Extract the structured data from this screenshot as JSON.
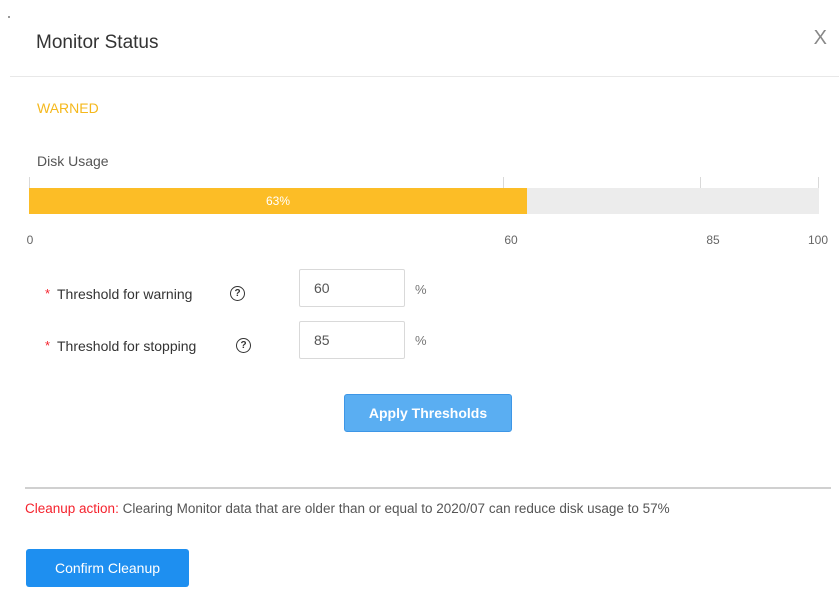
{
  "dialog": {
    "title": "Monitor Status",
    "close_label": "X"
  },
  "status": {
    "label": "WARNED",
    "color": "#f5b81c"
  },
  "disk": {
    "label": "Disk Usage",
    "usage_percent": 63,
    "usage_text": "63%",
    "scale_ticks": [
      "0",
      "60",
      "85",
      "100"
    ],
    "bar_color": "#fcbd26",
    "track_color": "#ececec"
  },
  "form": {
    "warning": {
      "required_mark": "*",
      "label": "Threshold for warning",
      "help_icon": "question-circle-icon",
      "value": "60",
      "unit": "%"
    },
    "stopping": {
      "required_mark": "*",
      "label": "Threshold for stopping",
      "help_icon": "question-circle-icon",
      "value": "85",
      "unit": "%"
    },
    "apply_label": "Apply Thresholds"
  },
  "cleanup": {
    "key": "Cleanup action:",
    "text": " Clearing Monitor data that are older than or equal to 2020/07 can reduce disk usage to 57%",
    "confirm_label": "Confirm Cleanup"
  }
}
